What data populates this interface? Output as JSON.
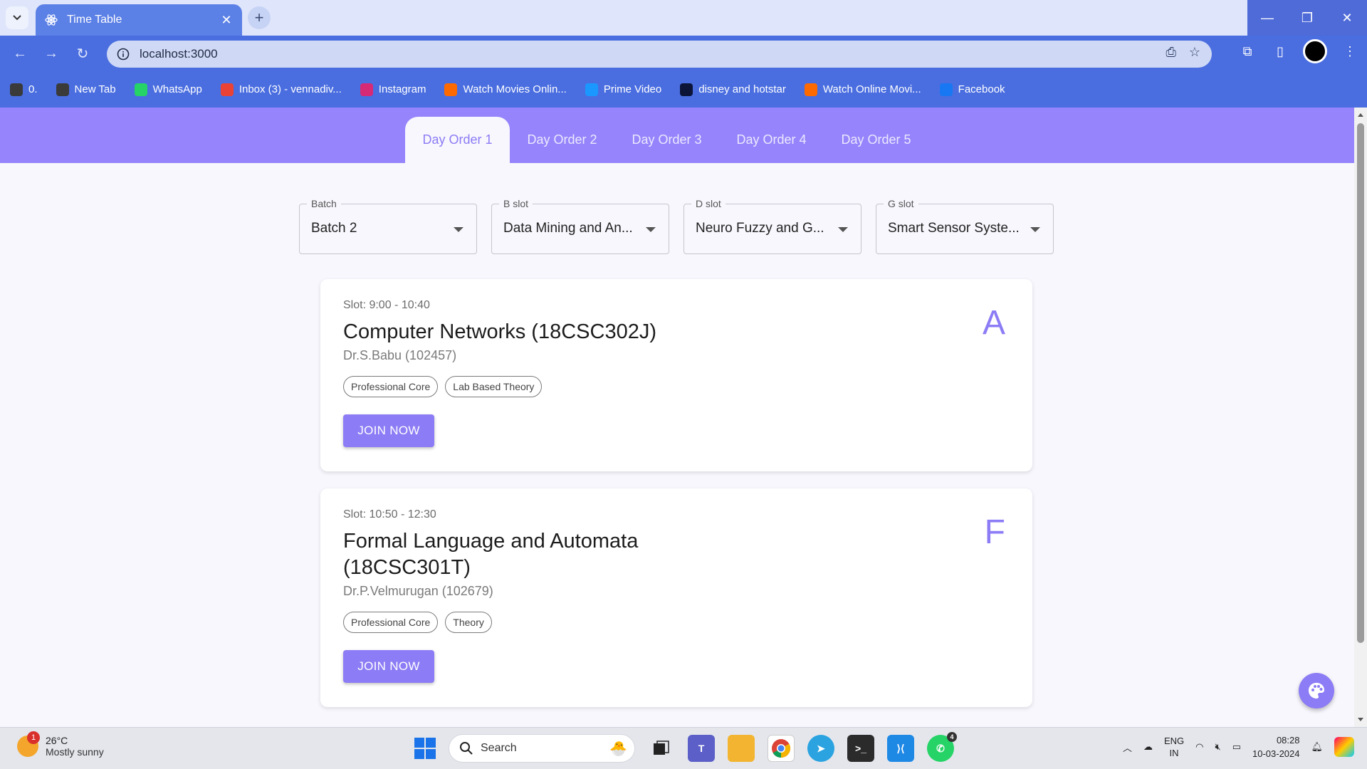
{
  "browser": {
    "tab_title": "Time Table",
    "tab_close": "✕",
    "new_tab": "+",
    "url": "localhost:3000",
    "bookmarks": [
      {
        "label": "0.",
        "icon": "globe-icon",
        "color": "#3a3a3a"
      },
      {
        "label": "New Tab",
        "icon": "globe-icon",
        "color": "#3a3a3a"
      },
      {
        "label": "WhatsApp",
        "icon": "whatsapp-icon",
        "color": "#25d366"
      },
      {
        "label": "Inbox (3) - vennadiv...",
        "icon": "gmail-icon",
        "color": "#ea4335"
      },
      {
        "label": "Instagram",
        "icon": "instagram-icon",
        "color": "#d62976"
      },
      {
        "label": "Watch Movies Onlin...",
        "icon": "aha-icon",
        "color": "#ff6a00"
      },
      {
        "label": "Prime Video",
        "icon": "prime-video-icon",
        "color": "#1a98ff"
      },
      {
        "label": "disney and hotstar",
        "icon": "hotstar-icon",
        "color": "#0c1538"
      },
      {
        "label": "Watch Online Movi...",
        "icon": "aha-icon",
        "color": "#ff6a00"
      },
      {
        "label": "Facebook",
        "icon": "facebook-icon",
        "color": "#1877f2"
      }
    ]
  },
  "app": {
    "tabs": [
      {
        "label": "Day Order 1",
        "active": true
      },
      {
        "label": "Day Order 2",
        "active": false
      },
      {
        "label": "Day Order 3",
        "active": false
      },
      {
        "label": "Day Order 4",
        "active": false
      },
      {
        "label": "Day Order 5",
        "active": false
      }
    ],
    "selects": [
      {
        "label": "Batch",
        "value": "Batch 2"
      },
      {
        "label": "B slot",
        "value": "Data Mining and An..."
      },
      {
        "label": "D slot",
        "value": "Neuro Fuzzy and G..."
      },
      {
        "label": "G slot",
        "value": "Smart Sensor Syste..."
      }
    ],
    "classes": [
      {
        "slot": "Slot: 9:00 - 10:40",
        "course": "Computer Networks (18CSC302J)",
        "faculty": "Dr.S.Babu (102457)",
        "tags": [
          "Professional Core",
          "Lab Based Theory"
        ],
        "join_label": "JOIN NOW",
        "letter": "A"
      },
      {
        "slot": "Slot: 10:50 - 12:30",
        "course": "Formal Language and Automata (18CSC301T)",
        "faculty": "Dr.P.Velmurugan (102679)",
        "tags": [
          "Professional Core",
          "Theory"
        ],
        "join_label": "JOIN NOW",
        "letter": "F"
      }
    ],
    "accent_color": "#8c7cf5",
    "appbar_color": "#9584fb"
  },
  "taskbar": {
    "weather_badge": "1",
    "temperature": "26°C",
    "weather": "Mostly sunny",
    "search_label": "Search",
    "whatsapp_badge": "4",
    "lang_1": "ENG",
    "lang_2": "IN",
    "time": "08:28",
    "date": "10-03-2024"
  }
}
